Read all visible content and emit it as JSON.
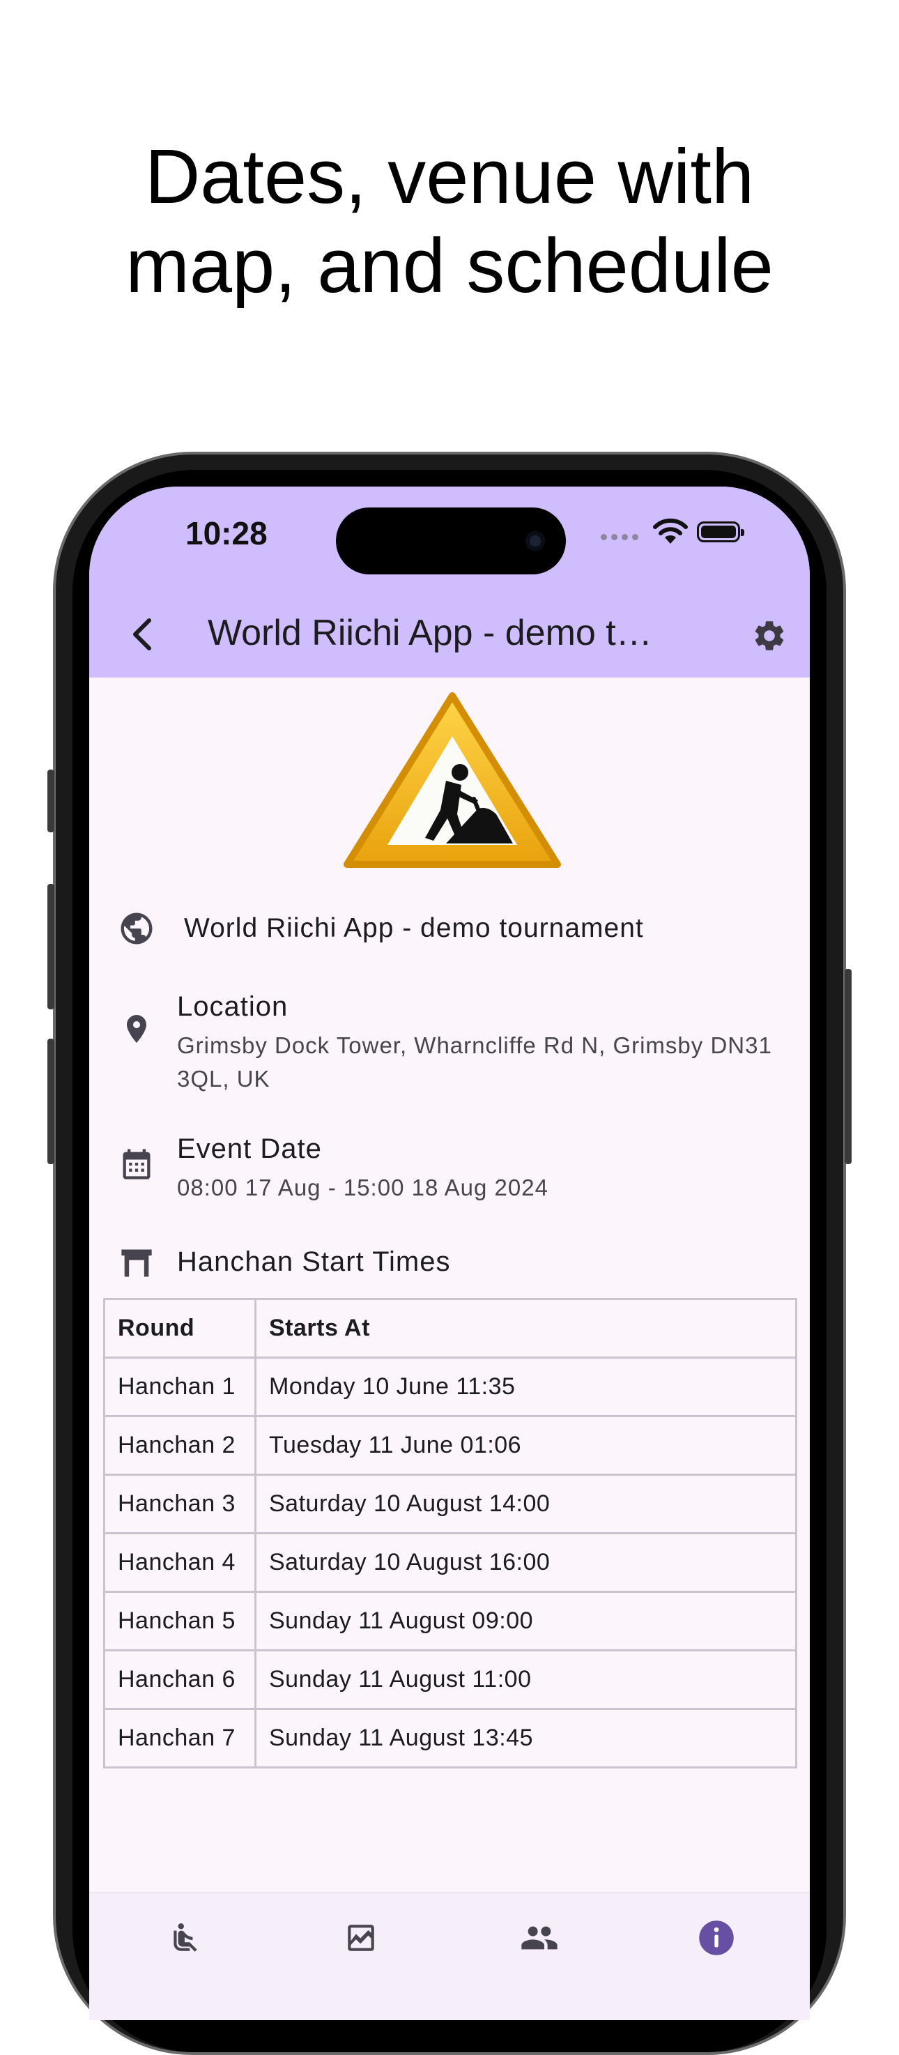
{
  "headline": {
    "line1": "Dates, venue with",
    "line2": "map, and schedule"
  },
  "status_bar": {
    "time": "10:28"
  },
  "app_bar": {
    "title": "World Riichi App - demo tournament",
    "back_icon": "chevron-left-icon",
    "settings_icon": "gear-icon"
  },
  "banner_icon": "under-construction-sign-icon",
  "tournament": {
    "name": "World Riichi App - demo tournament",
    "location_label": "Location",
    "location_value": "Grimsby Dock Tower, Wharncliffe Rd N, Grimsby DN31 3QL, UK",
    "date_label": "Event Date",
    "date_value": "08:00 17 Aug - 15:00 18 Aug 2024",
    "schedule_label": "Hanchan Start Times"
  },
  "schedule": {
    "headers": [
      "Round",
      "Starts At"
    ],
    "rows": [
      [
        "Hanchan 1",
        "Monday 10 June 11:35"
      ],
      [
        "Hanchan 2",
        "Tuesday 11 June 01:06"
      ],
      [
        "Hanchan 3",
        "Saturday 10 August 14:00"
      ],
      [
        "Hanchan 4",
        "Saturday 10 August 16:00"
      ],
      [
        "Hanchan 5",
        "Sunday 11 August 09:00"
      ],
      [
        "Hanchan 6",
        "Sunday 11 August 11:00"
      ],
      [
        "Hanchan 7",
        "Sunday 11 August 13:45"
      ]
    ]
  },
  "bottom_nav": {
    "items": [
      {
        "icon": "seat-icon"
      },
      {
        "icon": "ranking-icon"
      },
      {
        "icon": "players-icon"
      },
      {
        "icon": "info-icon",
        "active": true
      }
    ]
  },
  "colors": {
    "app_bar": "#cfbdfd",
    "background": "#fcf6fc",
    "accent": "#6750a4"
  }
}
